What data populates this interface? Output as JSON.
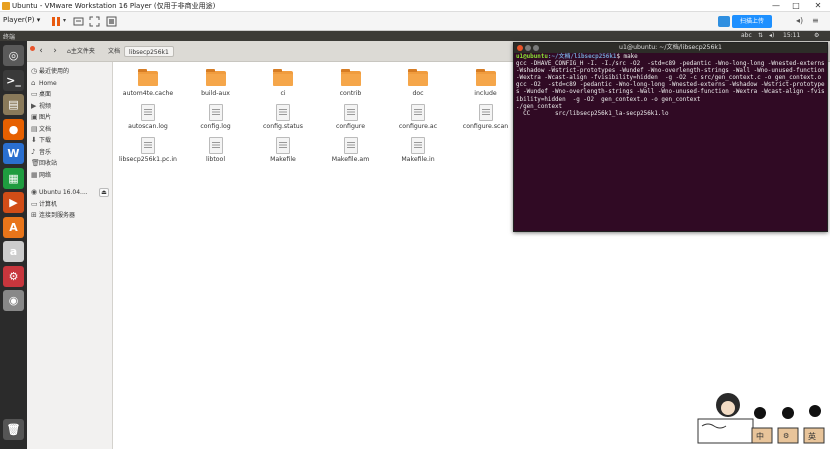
{
  "vmware": {
    "title": "Ubuntu - VMware Workstation 16 Player (仅用于非商业用途)",
    "player_menu": "Player(P)",
    "upload_label": "扫描上传",
    "min_label": "—",
    "max_label": "□",
    "close_label": "✕"
  },
  "ubuntu_panel": {
    "app_name": "终端",
    "keyboard": "abc",
    "time": "15:11"
  },
  "file_manager": {
    "breadcrumbs": [
      "主文件夹",
      "文档",
      "libsecp256k1"
    ],
    "sidebar": [
      {
        "icon": "clock-icon",
        "glyph": "◷",
        "label": "最近使用的"
      },
      {
        "icon": "home-icon",
        "glyph": "⌂",
        "label": "Home"
      },
      {
        "icon": "desktop-icon",
        "glyph": "▭",
        "label": "桌面"
      },
      {
        "icon": "video-icon",
        "glyph": "▶",
        "label": "视频"
      },
      {
        "icon": "picture-icon",
        "glyph": "▣",
        "label": "图片"
      },
      {
        "icon": "document-icon",
        "glyph": "▤",
        "label": "文档"
      },
      {
        "icon": "download-icon",
        "glyph": "⬇",
        "label": "下载"
      },
      {
        "icon": "music-icon",
        "glyph": "♪",
        "label": "音乐"
      },
      {
        "icon": "trash-icon",
        "glyph": "🗑",
        "label": "回收站"
      },
      {
        "icon": "network-icon",
        "glyph": "▦",
        "label": "网络"
      },
      {
        "icon": "disc-icon",
        "glyph": "◉",
        "label": "Ubuntu 16.04...."
      },
      {
        "icon": "computer-icon",
        "glyph": "▭",
        "label": "计算机"
      },
      {
        "icon": "server-icon",
        "glyph": "⊞",
        "label": "连接到服务器"
      }
    ],
    "files": [
      {
        "name": "autom4te.cache",
        "type": "folder"
      },
      {
        "name": "build-aux",
        "type": "folder"
      },
      {
        "name": "ci",
        "type": "folder"
      },
      {
        "name": "contrib",
        "type": "folder"
      },
      {
        "name": "doc",
        "type": "folder"
      },
      {
        "name": "include",
        "type": "folder"
      },
      {
        "name": "autoscan.log",
        "type": "file"
      },
      {
        "name": "config.log",
        "type": "file"
      },
      {
        "name": "config.status",
        "type": "file"
      },
      {
        "name": "configure",
        "type": "file"
      },
      {
        "name": "configure.ac",
        "type": "file"
      },
      {
        "name": "configure.scan",
        "type": "file"
      },
      {
        "name": "libsecp256k1.pc.in",
        "type": "file"
      },
      {
        "name": "libtool",
        "type": "file"
      },
      {
        "name": "Makefile",
        "type": "file"
      },
      {
        "name": "Makefile.am",
        "type": "file"
      },
      {
        "name": "Makefile.in",
        "type": "file"
      }
    ]
  },
  "terminal": {
    "title": "u1@ubuntu: ~/文档/libsecp256k1",
    "prompt_user": "u1@ubuntu",
    "prompt_path": ":~/文档/libsecp256k1",
    "command": "$ make",
    "output": "gcc -DHAVE_CONFIG_H -I. -I./src -O2  -std=c89 -pedantic -Wno-long-long -Wnested-externs -Wshadow -Wstrict-prototypes -Wundef -Wno-overlength-strings -Wall -Wno-unused-function -Wextra -Wcast-align -fvisibility=hidden  -g -O2 -c src/gen_context.c -o gen_context.o\ngcc -O2  -std=c89 -pedantic -Wno-long-long -Wnested-externs -Wshadow -Wstrict-prototypes -Wundef -Wno-overlength-strings -Wall -Wno-unused-function -Wextra -Wcast-align -fvisibility=hidden  -g -O2  gen_context.o -o gen_context\n./gen_context\n  CC       src/libsecp256k1_la-secp256k1.lo"
  },
  "launcher": [
    {
      "icon": "dash-icon",
      "glyph": "◎",
      "color": "#5a5a5a"
    },
    {
      "icon": "terminal-icon",
      "glyph": ">_",
      "color": "#3a3a3a"
    },
    {
      "icon": "files-icon",
      "glyph": "▤",
      "color": "#8a7a5a"
    },
    {
      "icon": "firefox-icon",
      "glyph": "●",
      "color": "#e66000"
    },
    {
      "icon": "writer-icon",
      "glyph": "W",
      "color": "#2a6fcf"
    },
    {
      "icon": "calc-icon",
      "glyph": "▦",
      "color": "#1f9c3f"
    },
    {
      "icon": "impress-icon",
      "glyph": "▶",
      "color": "#d14d17"
    },
    {
      "icon": "software-icon",
      "glyph": "A",
      "color": "#e8751a"
    },
    {
      "icon": "amazon-icon",
      "glyph": "a",
      "color": "#cccccc"
    },
    {
      "icon": "settings-icon",
      "glyph": "⚙",
      "color": "#c7363d"
    },
    {
      "icon": "dvd-icon",
      "glyph": "◉",
      "color": "#888888"
    }
  ],
  "mascot": {
    "labels": [
      "中",
      "英"
    ]
  }
}
